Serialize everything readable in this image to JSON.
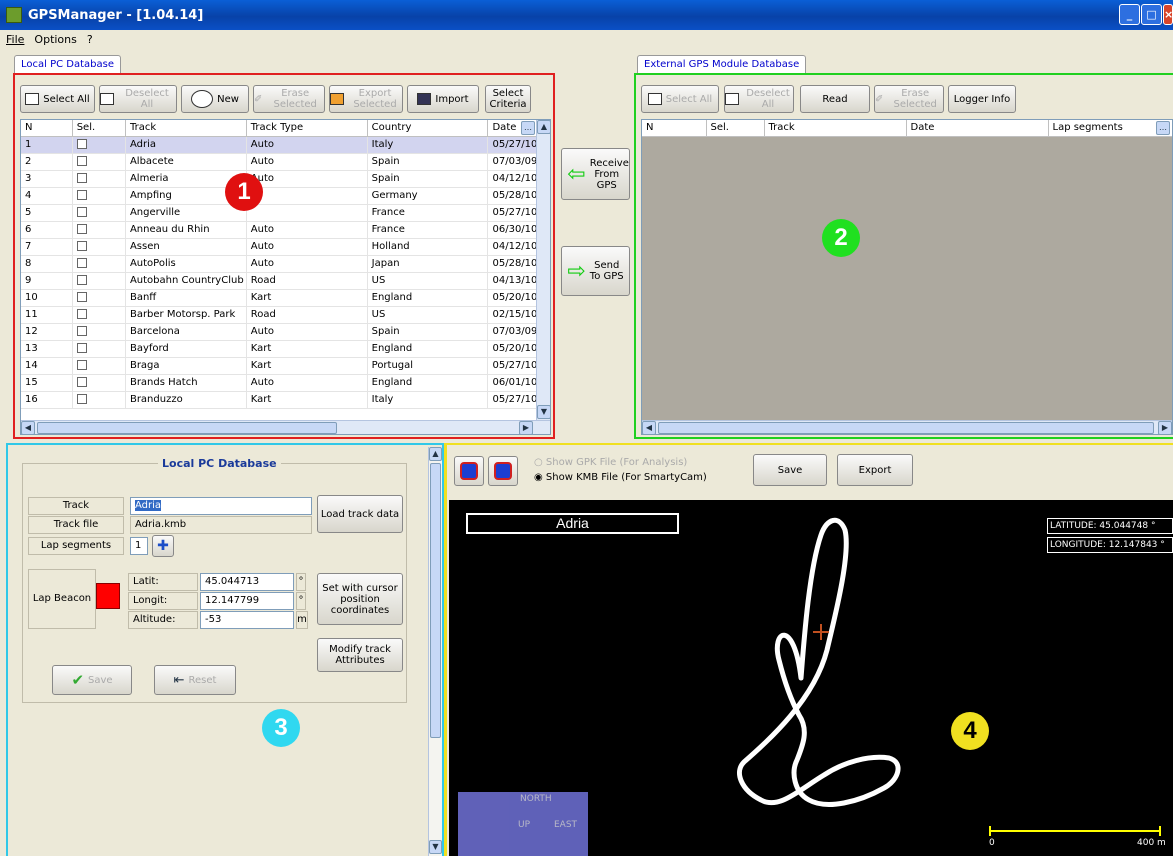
{
  "window": {
    "title": "GPSManager - [1.04.14]"
  },
  "menu": [
    "File",
    "Options",
    "?"
  ],
  "local_db": {
    "tab": "Local PC Database",
    "buttons": {
      "select_all": "Select All",
      "deselect_all": "Deselect All",
      "new": "New",
      "erase": "Erase Selected",
      "export": "Export Selected",
      "import": "Import",
      "criteria": "Select Criteria"
    },
    "columns": [
      "N",
      "Sel.",
      "Track",
      "Track Type",
      "Country",
      "Date"
    ],
    "rows": [
      [
        "1",
        "Adria",
        "Auto",
        "Italy",
        "05/27/10"
      ],
      [
        "2",
        "Albacete",
        "Auto",
        "Spain",
        "07/03/09"
      ],
      [
        "3",
        "Almeria",
        "Auto",
        "Spain",
        "04/12/10"
      ],
      [
        "4",
        "Ampfing",
        "",
        "Germany",
        "05/28/10"
      ],
      [
        "5",
        "Angerville",
        "",
        "France",
        "05/27/10"
      ],
      [
        "6",
        "Anneau du Rhin",
        "Auto",
        "France",
        "06/30/10"
      ],
      [
        "7",
        "Assen",
        "Auto",
        "Holland",
        "04/12/10"
      ],
      [
        "8",
        "AutoPolis",
        "Auto",
        "Japan",
        "05/28/10"
      ],
      [
        "9",
        "Autobahn CountryClub",
        "Road",
        "US",
        "04/13/10"
      ],
      [
        "10",
        "Banff",
        "Kart",
        "England",
        "05/20/10"
      ],
      [
        "11",
        "Barber Motorsp. Park",
        "Road",
        "US",
        "02/15/10"
      ],
      [
        "12",
        "Barcelona",
        "Auto",
        "Spain",
        "07/03/09"
      ],
      [
        "13",
        "Bayford",
        "Kart",
        "England",
        "05/20/10"
      ],
      [
        "14",
        "Braga",
        "Kart",
        "Portugal",
        "05/27/10"
      ],
      [
        "15",
        "Brands Hatch",
        "Auto",
        "England",
        "06/01/10"
      ],
      [
        "16",
        "Branduzzo",
        "Kart",
        "Italy",
        "05/27/10"
      ]
    ],
    "badge": "1"
  },
  "transfer": {
    "receive": "Receive From GPS",
    "send": "Send To GPS"
  },
  "external_db": {
    "tab": "External GPS Module Database",
    "buttons": {
      "select_all": "Select All",
      "deselect_all": "Deselect All",
      "read": "Read",
      "erase": "Erase Selected",
      "logger_info": "Logger Info"
    },
    "columns": [
      "N",
      "Sel.",
      "Track",
      "Date",
      "Lap segments"
    ],
    "badge": "2"
  },
  "detail": {
    "group_title": "Local PC Database",
    "track_label": "Track",
    "track_value": "Adria",
    "trackfile_label": "Track file",
    "trackfile_value": "Adria.kmb",
    "segments_label": "Lap segments",
    "segments_value": "1",
    "load_btn": "Load track data",
    "beacon_label": "Lap Beacon",
    "latit_label": "Latit:",
    "latit_value": "45.044713",
    "latit_unit": "°",
    "longit_label": "Longit:",
    "longit_value": "12.147799",
    "longit_unit": "°",
    "alt_label": "Altitude:",
    "alt_value": "-53",
    "alt_unit": "m",
    "cursor_btn": "Set with cursor position coordinates",
    "modify_btn": "Modify track Attributes",
    "save_btn": "Save",
    "reset_btn": "Reset",
    "beacon_color": "#ff0000",
    "badge": "3"
  },
  "map_panel": {
    "radio_gpk": "Show GPK File (For Analysis)",
    "radio_kmb": "Show KMB File (For SmartyCam)",
    "save_btn": "Save",
    "export_btn": "Export",
    "track_name": "Adria",
    "latitude": "LATITUDE: 45.044748 °",
    "longitude": "LONGITUDE: 12.147843 °",
    "north": "NORTH",
    "up": "UP",
    "east": "EAST",
    "scale": "400 m",
    "scale_zero": "0",
    "badge": "4"
  }
}
